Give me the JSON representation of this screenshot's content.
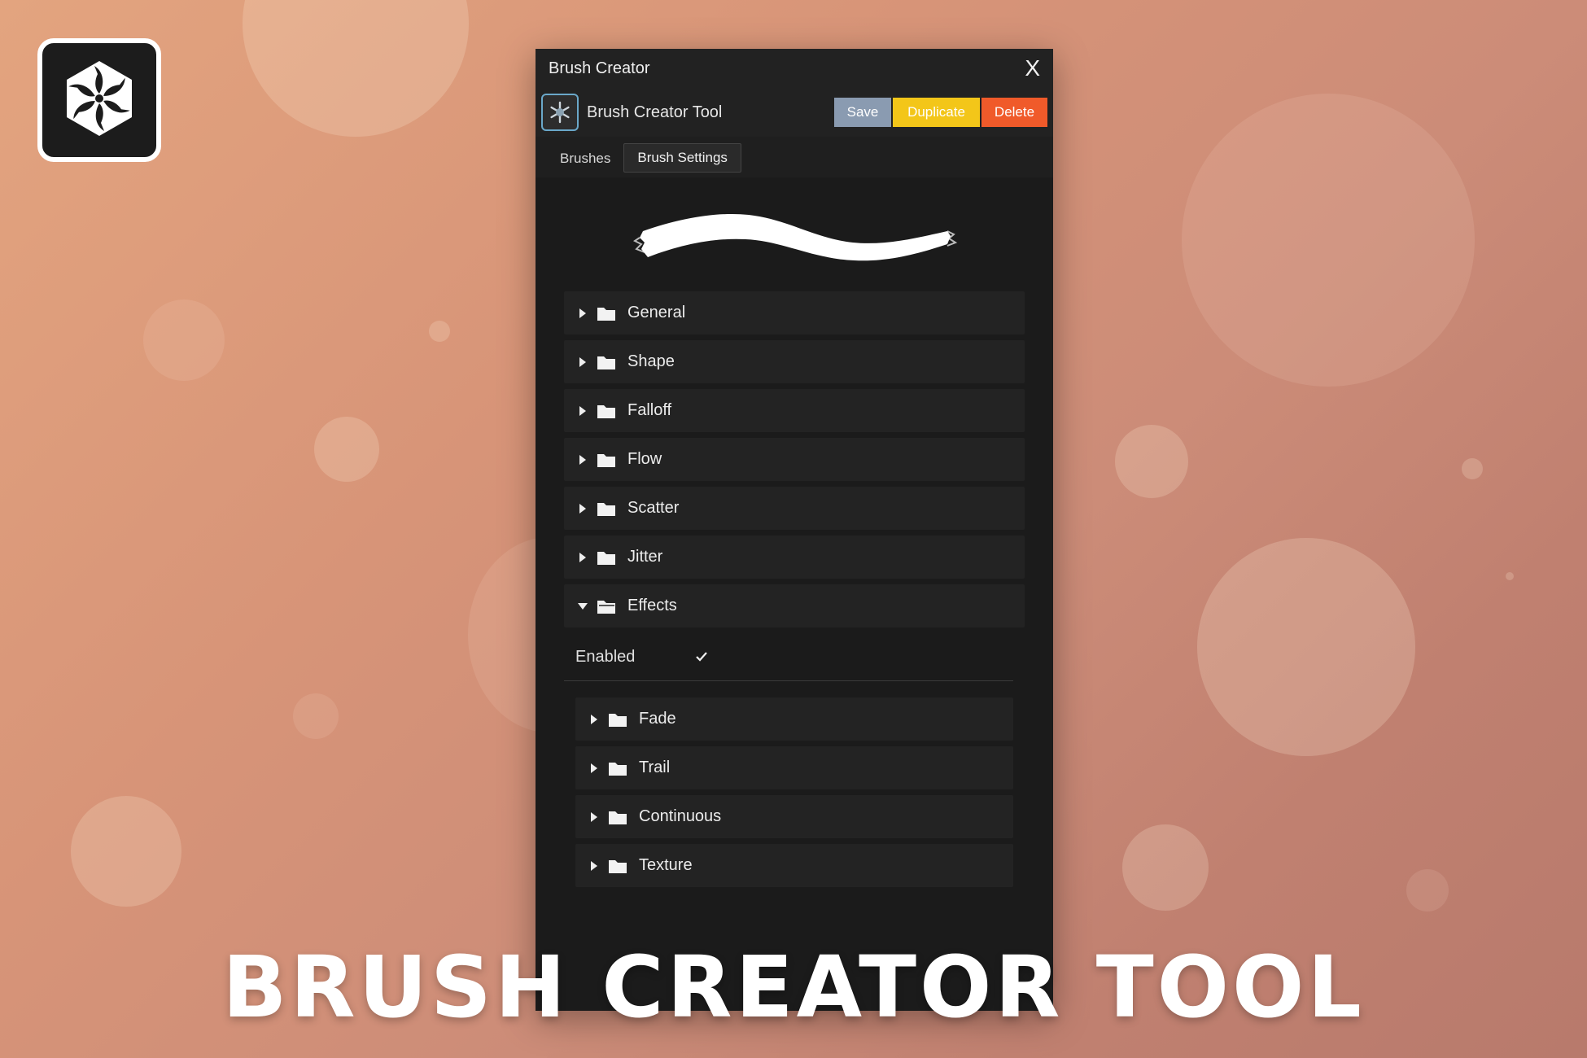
{
  "logo": {
    "icon": "aperture-hex-icon"
  },
  "window": {
    "title": "Brush Creator",
    "close_label": "X",
    "tool": {
      "icon": "snowflake-brush-icon",
      "name": "Brush Creator Tool"
    },
    "buttons": {
      "save": "Save",
      "duplicate": "Duplicate",
      "delete": "Delete"
    },
    "button_colors": {
      "save": "#8a9bb1",
      "duplicate": "#f3c619",
      "delete": "#f05a2a"
    },
    "tabs": [
      {
        "label": "Brushes",
        "active": false
      },
      {
        "label": "Brush Settings",
        "active": true
      }
    ],
    "preview": {
      "icon": "brush-stroke-preview"
    },
    "sections": [
      {
        "label": "General",
        "expanded": false
      },
      {
        "label": "Shape",
        "expanded": false
      },
      {
        "label": "Falloff",
        "expanded": false
      },
      {
        "label": "Flow",
        "expanded": false
      },
      {
        "label": "Scatter",
        "expanded": false
      },
      {
        "label": "Jitter",
        "expanded": false
      },
      {
        "label": "Effects",
        "expanded": true
      }
    ],
    "effects": {
      "enabled_label": "Enabled",
      "enabled": true,
      "subsections": [
        {
          "label": "Fade"
        },
        {
          "label": "Trail"
        },
        {
          "label": "Continuous"
        },
        {
          "label": "Texture"
        }
      ]
    }
  },
  "headline": "BRUSH CREATOR TOOL"
}
